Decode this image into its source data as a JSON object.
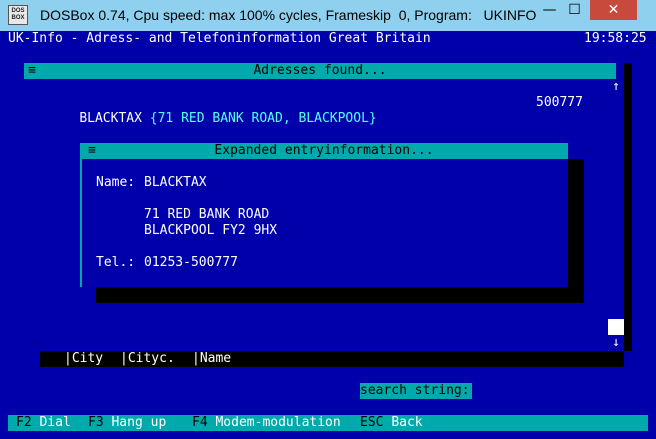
{
  "window": {
    "title": "DOSBox 0.74, Cpu speed: max 100% cycles, Frameskip  0, Program:   UKINFO",
    "icon_text": "DOS\nBOX",
    "minimize_icon": "minimize-icon",
    "maximize_icon": "maximize-icon",
    "close_icon": "close-icon",
    "minimize_glyph": "—",
    "maximize_glyph": "☐",
    "close_glyph": "✕"
  },
  "status_bar": {
    "app_title": "UK-Info - Adress- and Telefoninformation Great Britain",
    "time": "19:58:25"
  },
  "results_panel": {
    "menu_glyph": "≡",
    "title": "Adresses found...",
    "entry": {
      "name": "BLACKTAX",
      "address": "{71 RED BANK ROAD, BLACKPOOL}",
      "number": "500777"
    },
    "scroll_up_glyph": "↑",
    "scroll_down_glyph": "↓"
  },
  "expanded_panel": {
    "menu_glyph": "≡",
    "title": "Expanded entryinformation...",
    "name_label": "Name:",
    "name_value": "BLACKTAX",
    "address_line1": "71 RED BANK ROAD",
    "address_line2": "BLACKPOOL FY2 9HX",
    "tel_label": "Tel.:",
    "tel_value": "01253-500777"
  },
  "columns": [
    "City",
    "Cityc.",
    "Name"
  ],
  "search": {
    "label": "search string:",
    "value": ""
  },
  "footer": [
    {
      "key": "F2",
      "label": "Dial"
    },
    {
      "key": "F3",
      "label": "Hang up"
    },
    {
      "key": "F4",
      "label": "Modem-modulation"
    },
    {
      "key": "ESC",
      "label": "Back"
    }
  ],
  "colors": {
    "dos_blue": "#0000aa",
    "dos_cyan": "#00aaaa",
    "bright_cyan": "#55ffff",
    "titlebar": "#8fd0ef",
    "close_red": "#c74a3c"
  }
}
